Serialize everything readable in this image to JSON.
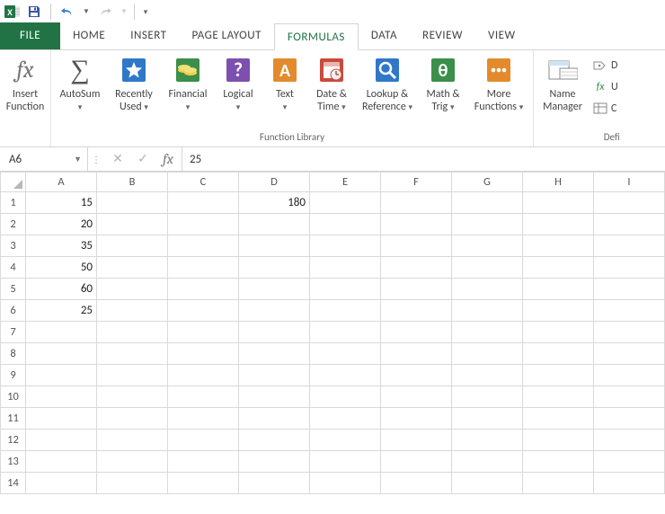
{
  "qat": {
    "save": "Save",
    "undo": "Undo",
    "redo": "Redo"
  },
  "tabs": {
    "file": "FILE",
    "home": "HOME",
    "insert": "INSERT",
    "page_layout": "PAGE LAYOUT",
    "formulas": "FORMULAS",
    "data": "DATA",
    "review": "REVIEW",
    "view": "VIEW"
  },
  "ribbon": {
    "insert_function": "Insert\nFunction",
    "autosum": "AutoSum",
    "recently_used": "Recently\nUsed",
    "financial": "Financial",
    "logical": "Logical",
    "text": "Text",
    "date_time": "Date &\nTime",
    "lookup_ref": "Lookup &\nReference",
    "math_trig": "Math &\nTrig",
    "more_functions": "More\nFunctions",
    "name_manager": "Name\nManager",
    "func_lib_label": "Function Library",
    "defined_names_partial": "Defi",
    "define_partial": "D",
    "use_in_partial": "U",
    "create_partial": "C"
  },
  "namebox": "A6",
  "formula_value": "25",
  "columns": [
    "A",
    "B",
    "C",
    "D",
    "E",
    "F",
    "G",
    "H",
    "I"
  ],
  "rows": [
    "1",
    "2",
    "3",
    "4",
    "5",
    "6",
    "7",
    "8",
    "9",
    "10",
    "11",
    "12",
    "13",
    "14"
  ],
  "cells": {
    "A1": "15",
    "A2": "20",
    "A3": "35",
    "A4": "50",
    "A5": "60",
    "A6": "25",
    "D1": "180"
  }
}
